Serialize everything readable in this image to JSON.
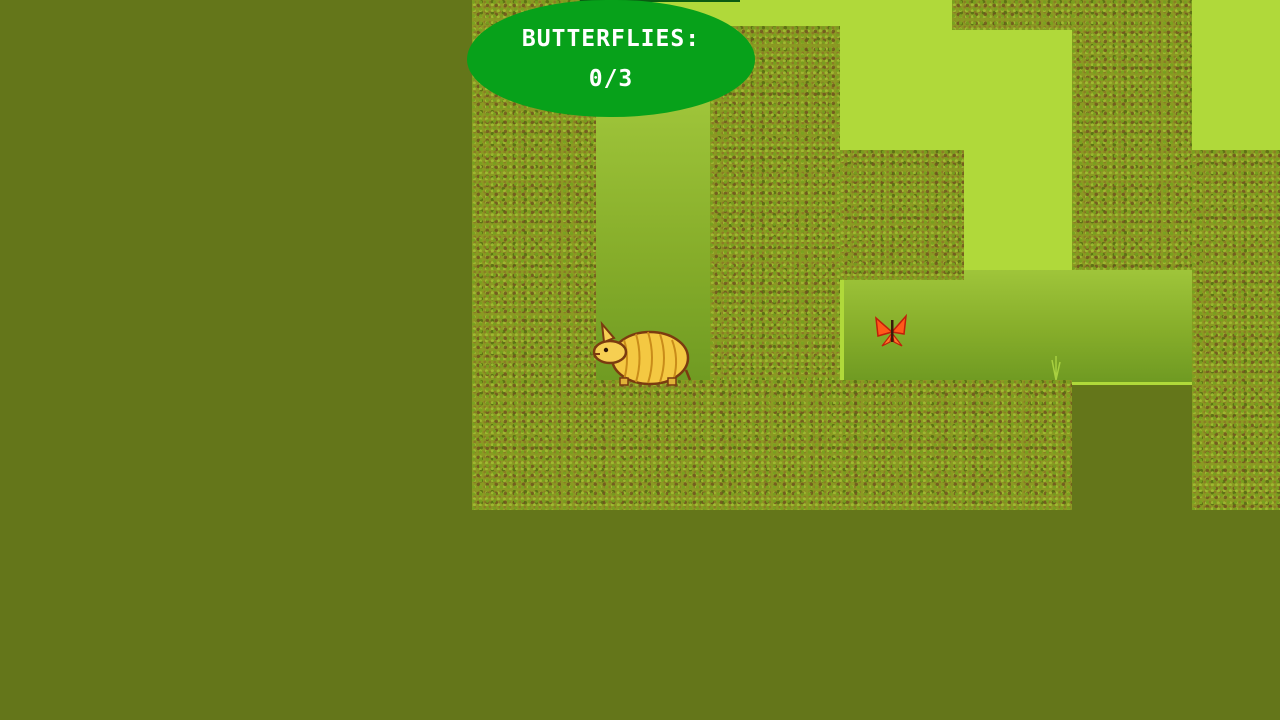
{
  "hud": {
    "label": "BUTTERFLIES:",
    "count": "0/3"
  },
  "colors": {
    "background": "#64761a",
    "sky": "#b0d93a",
    "hedge": "#8a9a22",
    "hud": "#07a11a",
    "hud_text": "#ffffff"
  },
  "sprites": {
    "player": "armadillo",
    "collectible": "butterfly"
  }
}
